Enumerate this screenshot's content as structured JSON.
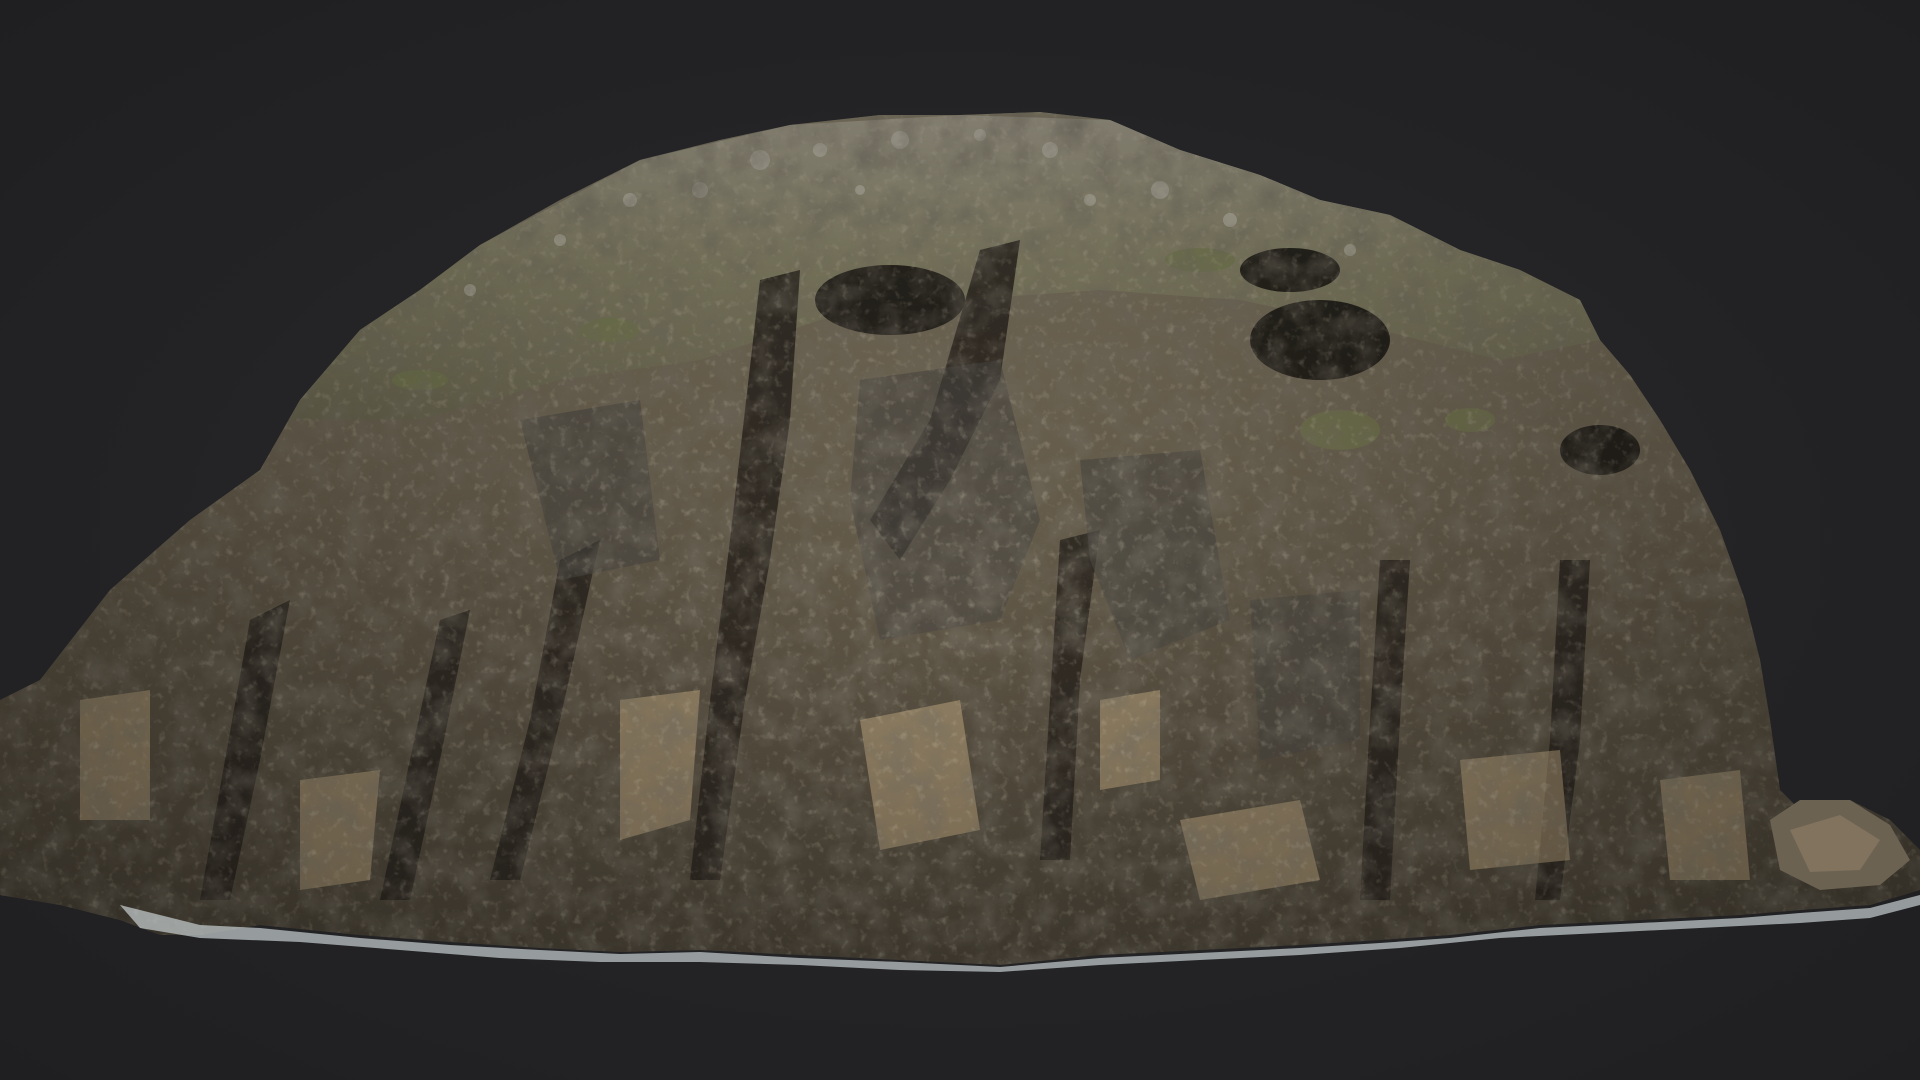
{
  "viewer": {
    "background_color": "#232325",
    "subject": "rock-outcrop-3d-model"
  },
  "rock": {
    "palette": {
      "dark_stone": "#3b372f",
      "mid_stone": "#6f6553",
      "light_stone": "#a8957a",
      "highlight_stone": "#c9b28c",
      "moss": "#7d8455",
      "pale_crust": "#b7b2a6",
      "foam": "#c8d0d2",
      "shadow": "#1e1c18"
    }
  }
}
